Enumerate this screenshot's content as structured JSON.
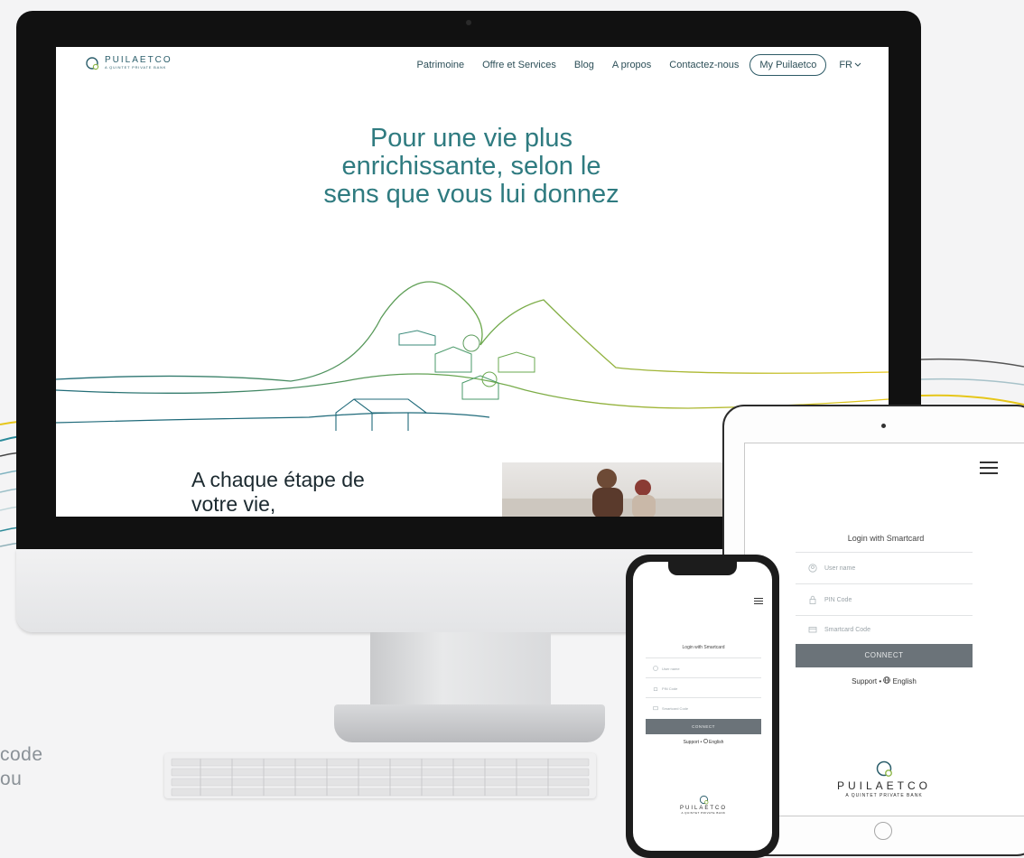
{
  "side_text": [
    "code",
    "ou"
  ],
  "website": {
    "logo": {
      "name": "PUILAETCO",
      "sub": "A QUINTET PRIVATE BANK"
    },
    "nav": {
      "items": [
        "Patrimoine",
        "Offre et Services",
        "Blog",
        "A propos",
        "Contactez-nous"
      ],
      "account_button": "My Puilaetco",
      "language": "FR"
    },
    "hero_title": "Pour une vie plus enrichissante, selon le sens que vous lui donnez",
    "step_text": "A chaque étape de votre vie,"
  },
  "login": {
    "title": "Login with Smartcard",
    "username_placeholder": "User name",
    "pin_placeholder": "PIN Code",
    "smartcard_placeholder": "Smartcard Code",
    "connect_label": "CONNECT",
    "support_label": "Support",
    "separator": "•",
    "language_label": "English"
  },
  "bank_logo": {
    "name": "PUILAETCO",
    "sub": "A QUINTET PRIVATE BANK"
  },
  "colors": {
    "teal": "#2f7b80",
    "connect_bg": "#6b7379",
    "line_green": "#8fb84a",
    "line_yellow": "#e6c619"
  },
  "icons": [
    "user-icon",
    "lock-icon",
    "card-icon",
    "globe-icon",
    "menu-icon",
    "chevron-down-icon",
    "logo-mark-icon"
  ]
}
